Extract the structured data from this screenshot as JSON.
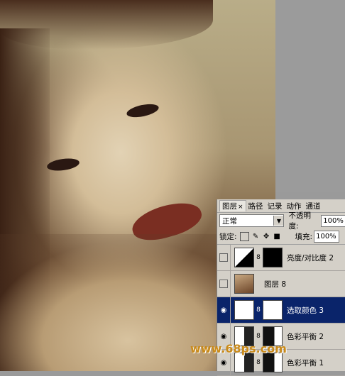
{
  "layers_panel": {
    "tabs": [
      "图层",
      "路径",
      "记录",
      "动作",
      "通道"
    ],
    "active_tab": "图层",
    "blend_mode": "正常",
    "opacity_label": "不透明度:",
    "opacity_value": "100%",
    "lock_label": "锁定:",
    "fill_label": "填充:",
    "fill_value": "100%",
    "layers": [
      {
        "name": "亮度/对比度 2",
        "visible": false,
        "selected": false,
        "thumb": "brightness-contrast-icon",
        "mask": "black"
      },
      {
        "name": "图层 8",
        "visible": false,
        "selected": false,
        "thumb": "photo",
        "mask": null
      },
      {
        "name": "选取颜色 3",
        "visible": true,
        "selected": true,
        "thumb": "selective-color-icon",
        "mask": "white"
      },
      {
        "name": "色彩平衡 2",
        "visible": true,
        "selected": false,
        "thumb": "color-balance-icon",
        "mask": "dark"
      },
      {
        "name": "色彩平衡 1",
        "visible": true,
        "selected": false,
        "thumb": "color-balance-icon",
        "mask": "dark"
      }
    ]
  },
  "watermark": "www.68ps.com"
}
